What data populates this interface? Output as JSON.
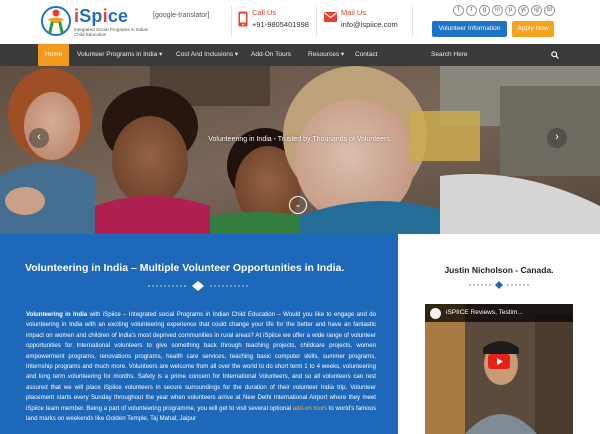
{
  "header": {
    "logo_title_a": "i",
    "logo_title_b": "Sp",
    "logo_title_c": "i",
    "logo_title_d": "ce",
    "logo_sub": "Integrated Social Programs in Indian Child Education",
    "translator": "[google-translator]",
    "call_label": "Call Us",
    "call_value": "+91-9805401998",
    "mail_label": "Mail Us",
    "mail_value": "info@ispiice.com",
    "socials": [
      "f",
      "t",
      "g",
      "in",
      "p",
      "yt",
      "ig",
      "bl"
    ],
    "volunteer_info": "Volunteer Information",
    "apply_now": "Apply Now"
  },
  "nav": {
    "items": [
      "Home",
      "Volunteer Programs in India",
      "Cost And Inclusions",
      "Add-On Tours",
      "Resources",
      "Contact"
    ],
    "dropdown_marker": "▾",
    "search_placeholder": "Search Here"
  },
  "hero": {
    "caption": "Volunteering in India - Trusted by Thousands of Volunteers.",
    "prev": "‹",
    "next": "›",
    "down": "⌄"
  },
  "content": {
    "title": "Volunteering in India – Multiple Volunteer Opportunities in India.",
    "para_lead": "Volunteering in India",
    "para_body": " with iSpiice – Integrated social Programs in Indian Child Education – Would you like to engage and do volunteering in India with an exciting volunteering experience that could change your life for the better and have an fantastic impact on women and children of India's most deprived communities in rural areas? At iSpiice we offer a wide range of volunteer opportunities for International volunteers to give something back through teaching projects, childcare projects, women empowerment programs, renovations programs, health care services, teaching basic computer skills, summer programs, Internship programs and much more. Volunteers are welcome from all over the world to do short term 1 to 4 weeks, volunteering and long term volunteering for months. Safety is a prime concern for International Volunteers, and so all volunteers can rest assured that we will place iSpiice volunteers in secure surroundings for the duration of their volunteer India trip. Volunteer placement starts every Sunday throughout the year when volunteers arrive at New Delhi International Airport where they meet iSpiice team member. Being a part of volunteering programme, you will get to visit several optional ",
    "para_link": "add-on tours",
    "para_tail": " to world's famous land marks on weekends like Golden Temple, Taj Mahal, Jaipur"
  },
  "sidebar": {
    "testimonial_name": "Justin Nicholson - Canada.",
    "video_title": "iSPIICE Reviews, Testim..."
  },
  "colors": {
    "accent_orange": "#f39a1e",
    "brand_blue": "#1d68b9",
    "nav_bg": "#3a3a3a",
    "logo_red": "#e8412b"
  }
}
